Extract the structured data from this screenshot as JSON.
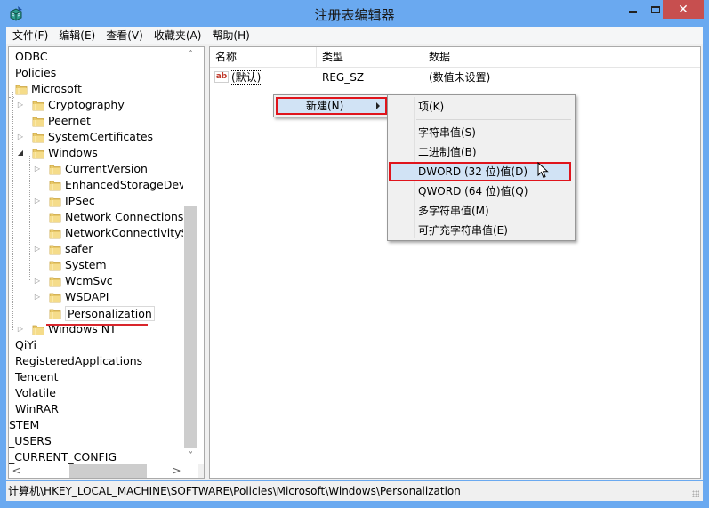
{
  "window": {
    "title": "注册表编辑器",
    "app_icon": "regedit-icon",
    "controls": {
      "minimize": "minimize-icon",
      "maximize": "maximize-icon",
      "close": "✕"
    }
  },
  "menubar": {
    "items": [
      "文件(F)",
      "编辑(E)",
      "查看(V)",
      "收藏夹(A)",
      "帮助(H)"
    ]
  },
  "tree": {
    "items": [
      {
        "label": "ODBC",
        "level": 0,
        "folder": false,
        "expander": ""
      },
      {
        "label": "Policies",
        "level": 0,
        "folder": false,
        "expander": ""
      },
      {
        "label": "Microsoft",
        "level": 1,
        "folder": true,
        "expander": ""
      },
      {
        "label": "Cryptography",
        "level": 2,
        "folder": true,
        "expander": "collapsed"
      },
      {
        "label": "Peernet",
        "level": 2,
        "folder": true,
        "expander": ""
      },
      {
        "label": "SystemCertificates",
        "level": 2,
        "folder": true,
        "expander": "collapsed"
      },
      {
        "label": "Windows",
        "level": 2,
        "folder": true,
        "expander": "expanded"
      },
      {
        "label": "CurrentVersion",
        "level": 3,
        "folder": true,
        "expander": "collapsed"
      },
      {
        "label": "EnhancedStorageDevic",
        "level": 3,
        "folder": true,
        "expander": ""
      },
      {
        "label": "IPSec",
        "level": 3,
        "folder": true,
        "expander": "collapsed"
      },
      {
        "label": "Network Connections",
        "level": 3,
        "folder": true,
        "expander": ""
      },
      {
        "label": "NetworkConnectivitySta",
        "level": 3,
        "folder": true,
        "expander": ""
      },
      {
        "label": "safer",
        "level": 3,
        "folder": true,
        "expander": "collapsed"
      },
      {
        "label": "System",
        "level": 3,
        "folder": true,
        "expander": ""
      },
      {
        "label": "WcmSvc",
        "level": 3,
        "folder": true,
        "expander": "collapsed"
      },
      {
        "label": "WSDAPI",
        "level": 3,
        "folder": true,
        "expander": "collapsed"
      },
      {
        "label": "Personalization",
        "level": 3,
        "folder": true,
        "expander": "",
        "selected": true
      },
      {
        "label": "Windows NT",
        "level": 2,
        "folder": true,
        "expander": "collapsed"
      },
      {
        "label": "QiYi",
        "level": 0,
        "folder": false,
        "expander": ""
      },
      {
        "label": "RegisteredApplications",
        "level": 0,
        "folder": false,
        "expander": ""
      },
      {
        "label": "Tencent",
        "level": 0,
        "folder": false,
        "expander": ""
      },
      {
        "label": "Volatile",
        "level": 0,
        "folder": false,
        "expander": ""
      },
      {
        "label": "WinRAR",
        "level": 0,
        "folder": false,
        "expander": ""
      },
      {
        "label": "STEM",
        "level": -1,
        "folder": false,
        "expander": ""
      },
      {
        "label": "_USERS",
        "level": -1,
        "folder": false,
        "expander": ""
      },
      {
        "label": "_CURRENT_CONFIG",
        "level": -1,
        "folder": false,
        "expander": ""
      }
    ],
    "scroll": {
      "up": "˄",
      "down": "˅",
      "left": "<",
      "right": ">"
    }
  },
  "list": {
    "columns": [
      "名称",
      "类型",
      "数据"
    ],
    "rows": [
      {
        "icon": "ab",
        "name": "(默认)",
        "type": "REG_SZ",
        "data": "(数值未设置)"
      }
    ]
  },
  "context_menu": {
    "parent_item": "新建(N)",
    "submenu": {
      "items": [
        {
          "label": "项(K)"
        },
        {
          "separator": true
        },
        {
          "label": "字符串值(S)"
        },
        {
          "label": "二进制值(B)"
        },
        {
          "label": "DWORD (32 位)值(D)",
          "highlighted": true
        },
        {
          "label": "QWORD (64 位)值(Q)"
        },
        {
          "label": "多字符串值(M)"
        },
        {
          "label": "可扩充字符串值(E)"
        }
      ]
    }
  },
  "statusbar": {
    "path": "计算机\\HKEY_LOCAL_MACHINE\\SOFTWARE\\Policies\\Microsoft\\Windows\\Personalization"
  },
  "colors": {
    "titlebar": "#6aa9f0",
    "close_button": "#c74f4f",
    "highlight": "#d1e3f5",
    "annotation_red": "#e0141c"
  }
}
